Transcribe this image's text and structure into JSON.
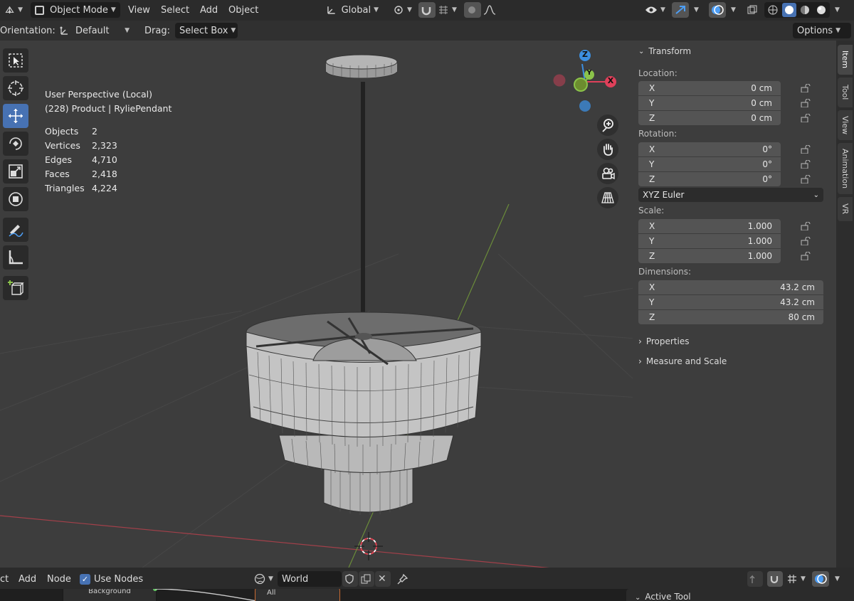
{
  "header": {
    "mode": "Object Mode",
    "menus": [
      "View",
      "Select",
      "Add",
      "Object"
    ],
    "orientation_global": "Global"
  },
  "tool_header": {
    "orientation_label": "Orientation:",
    "orientation_value": "Default",
    "drag_label": "Drag:",
    "drag_value": "Select Box",
    "options": "Options"
  },
  "overlay": {
    "perspective": "User Perspective (Local)",
    "object": "(228) Product | RyliePendant",
    "stats": [
      {
        "label": "Objects",
        "value": "2"
      },
      {
        "label": "Vertices",
        "value": "2,323"
      },
      {
        "label": "Edges",
        "value": "4,710"
      },
      {
        "label": "Faces",
        "value": "2,418"
      },
      {
        "label": "Triangles",
        "value": "4,224"
      }
    ]
  },
  "gizmo": {
    "z": "Z",
    "y": "Y",
    "x": "X"
  },
  "npanel": {
    "transform_title": "Transform",
    "location_label": "Location:",
    "location": [
      {
        "axis": "X",
        "value": "0 cm"
      },
      {
        "axis": "Y",
        "value": "0 cm"
      },
      {
        "axis": "Z",
        "value": "0 cm"
      }
    ],
    "rotation_label": "Rotation:",
    "rotation": [
      {
        "axis": "X",
        "value": "0°"
      },
      {
        "axis": "Y",
        "value": "0°"
      },
      {
        "axis": "Z",
        "value": "0°"
      }
    ],
    "rotation_mode": "XYZ Euler",
    "scale_label": "Scale:",
    "scale": [
      {
        "axis": "X",
        "value": "1.000"
      },
      {
        "axis": "Y",
        "value": "1.000"
      },
      {
        "axis": "Z",
        "value": "1.000"
      }
    ],
    "dimensions_label": "Dimensions:",
    "dimensions": [
      {
        "axis": "X",
        "value": "43.2 cm"
      },
      {
        "axis": "Y",
        "value": "43.2 cm"
      },
      {
        "axis": "Z",
        "value": "80 cm"
      }
    ],
    "properties_title": "Properties",
    "measure_title": "Measure and Scale"
  },
  "side_tabs": [
    "Item",
    "Tool",
    "View",
    "Animation",
    "VR"
  ],
  "bottom": {
    "menus": [
      "ct",
      "Add",
      "Node"
    ],
    "use_nodes": "Use Nodes",
    "world": "World",
    "node_label": "Background",
    "dropdown": "All",
    "active_tool": "Active Tool"
  },
  "colors": {
    "accent": "#4772b3",
    "x_axis": "#e0405a",
    "y_axis": "#8bc34a",
    "z_axis": "#3c8fe0"
  }
}
